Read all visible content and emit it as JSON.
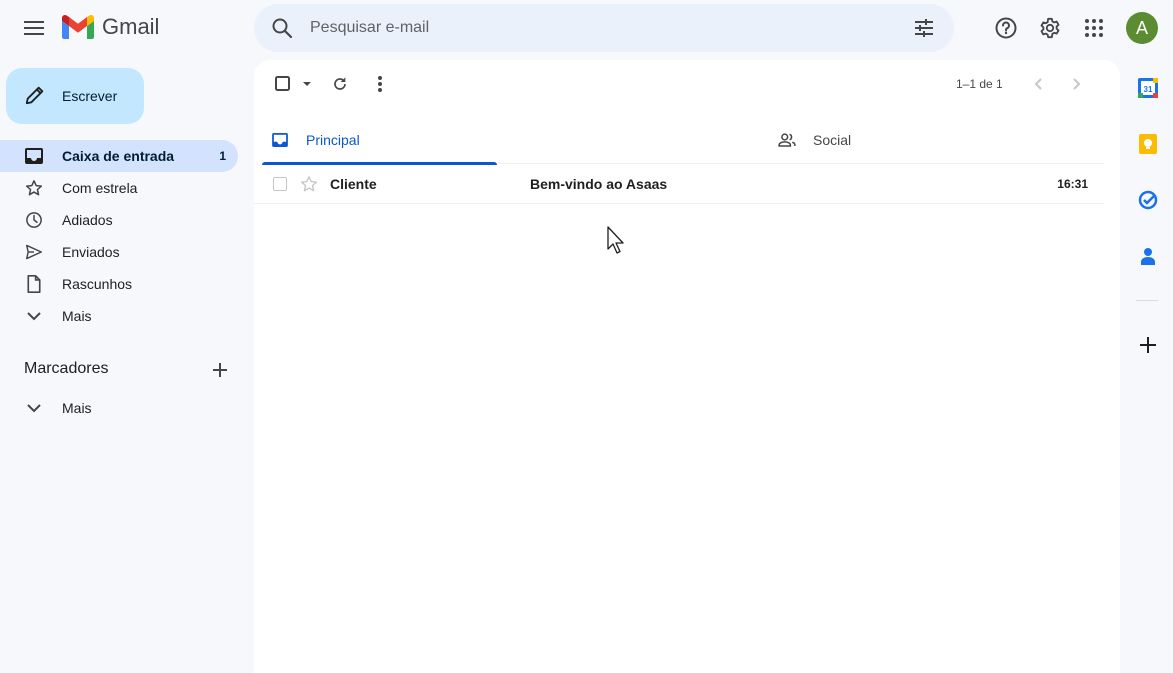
{
  "app": {
    "name": "Gmail"
  },
  "search": {
    "placeholder": "Pesquisar e-mail"
  },
  "user": {
    "avatar_letter": "A",
    "avatar_color": "#5b8c32"
  },
  "compose": {
    "label": "Escrever"
  },
  "sidebar": {
    "items": [
      {
        "label": "Caixa de entrada",
        "count": "1",
        "icon": "inbox-icon",
        "active": true
      },
      {
        "label": "Com estrela",
        "icon": "star-icon"
      },
      {
        "label": "Adiados",
        "icon": "clock-icon"
      },
      {
        "label": "Enviados",
        "icon": "send-icon"
      },
      {
        "label": "Rascunhos",
        "icon": "draft-icon"
      },
      {
        "label": "Mais",
        "icon": "chevron-down-icon"
      }
    ],
    "labels_title": "Marcadores",
    "labels_more": "Mais"
  },
  "toolbar": {
    "pagination": "1–1 de 1"
  },
  "tabs": [
    {
      "label": "Principal",
      "icon": "inbox-icon",
      "active": true
    },
    {
      "label": "Social",
      "icon": "people-icon"
    }
  ],
  "emails": [
    {
      "sender": "Cliente",
      "subject": "Bem-vindo ao Asaas",
      "time": "16:31",
      "unread": true
    }
  ],
  "colors": {
    "accent": "#0b57d0",
    "compose_bg": "#c2e7ff",
    "active_nav_bg": "#d3e3fd",
    "page_bg": "#f6f8fc",
    "search_bg": "#eaf1fb"
  }
}
